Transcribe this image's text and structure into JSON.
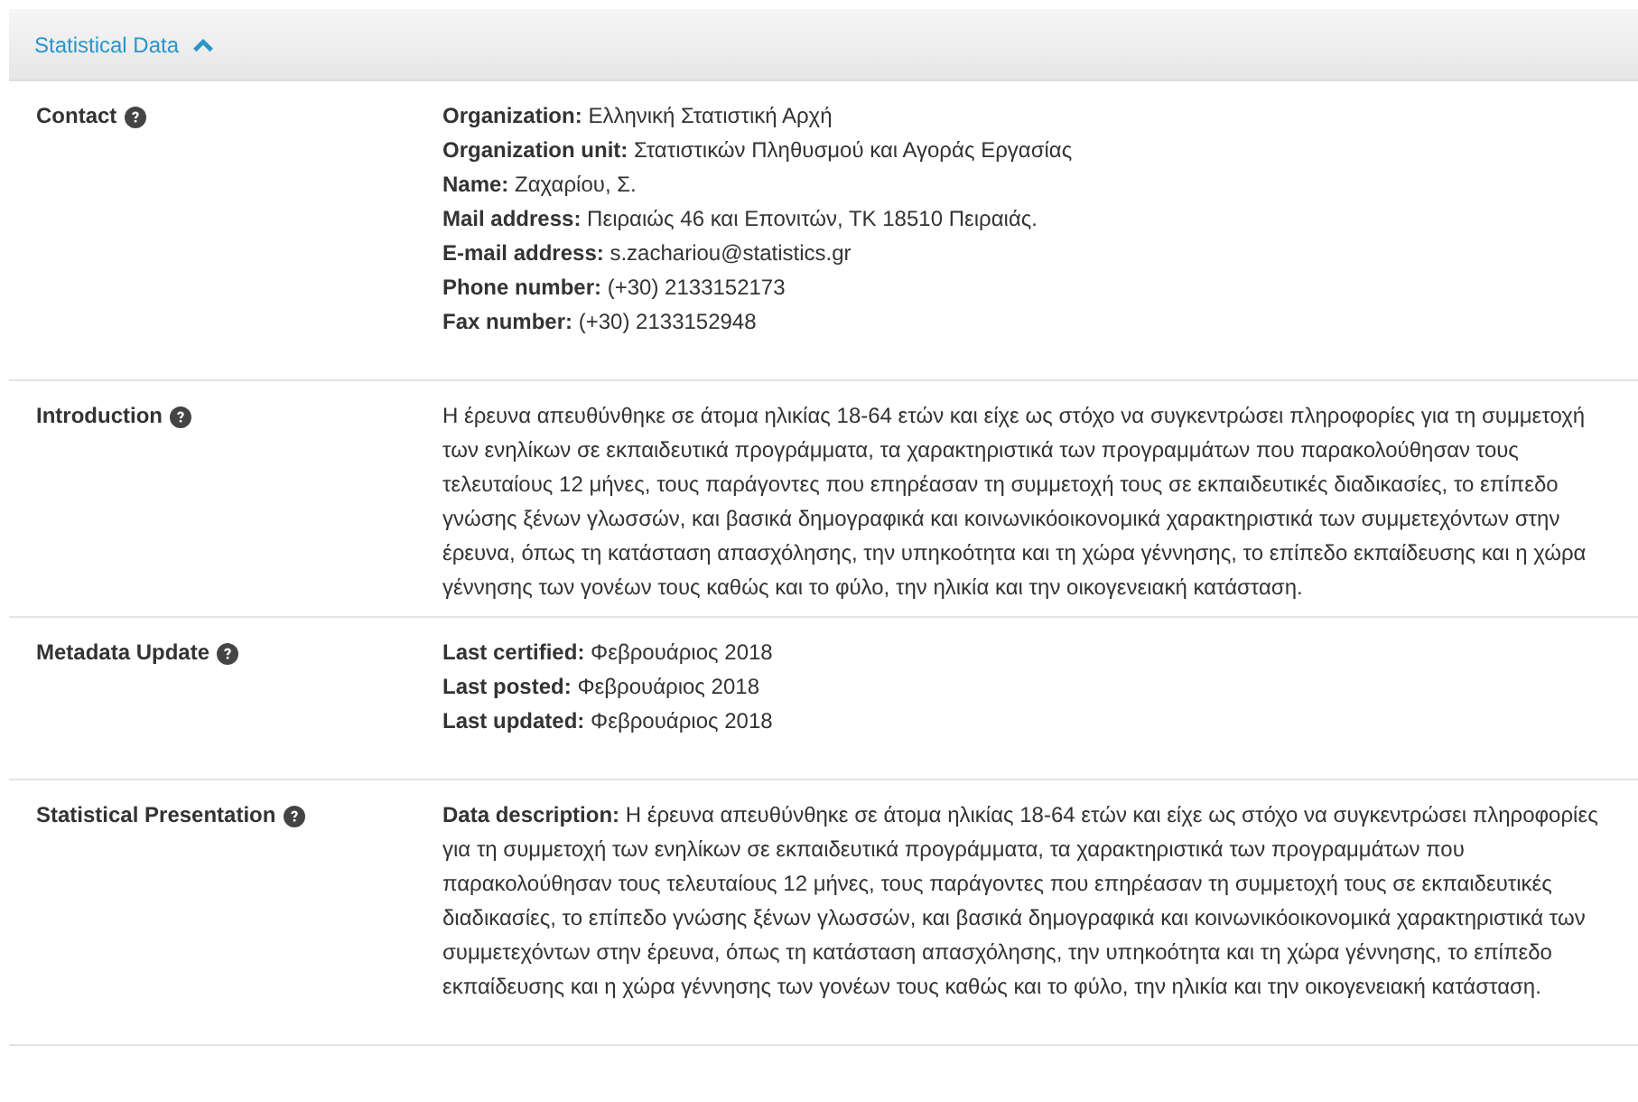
{
  "panel": {
    "title": "Statistical Data",
    "expanded": true
  },
  "sections": [
    {
      "label": "Contact",
      "kind": "fields",
      "fields": [
        {
          "label": "Organization:",
          "value": "Ελληνική Στατιστική Αρχή"
        },
        {
          "label": "Organization unit:",
          "value": "Στατιστικών Πληθυσμού και Αγοράς Εργασίας"
        },
        {
          "label": "Name:",
          "value": "Ζαχαρίου, Σ."
        },
        {
          "label": "Mail address:",
          "value": "Πειραιώς 46 και Επονιτών, ΤΚ 18510 Πειραιάς."
        },
        {
          "label": "E-mail address:",
          "value": "s.zachariou@statistics.gr"
        },
        {
          "label": "Phone number:",
          "value": "(+30) 2133152173"
        },
        {
          "label": "Fax number:",
          "value": "(+30) 2133152948"
        }
      ]
    },
    {
      "label": "Introduction",
      "kind": "text",
      "text": "Η έρευνα απευθύνθηκε σε άτομα ηλικίας 18-64 ετών και είχε ως στόχο να συγκεντρώσει πληροφορίες για τη συμμετοχή των ενηλίκων σε εκπαιδευτικά προγράμματα, τα χαρακτηριστικά των προγραμμάτων που παρακολούθησαν τους τελευταίους 12 μήνες, τους παράγοντες που επηρέασαν τη συμμετοχή τους σε εκπαιδευτικές διαδικασίες, το επίπεδο γνώσης ξένων γλωσσών, και βασικά δημογραφικά και κοινωνικόοικονομικά χαρακτηριστικά των συμμετεχόντων στην έρευνα, όπως τη κατάσταση απασχόλησης, την υπηκοότητα και τη χώρα γέννησης, το επίπεδο εκπαίδευσης και η χώρα γέννησης των γονέων τους καθώς και το φύλο, την ηλικία και την οικογενειακή κατάσταση."
    },
    {
      "label": "Metadata Update",
      "kind": "fields",
      "fields": [
        {
          "label": "Last certified:",
          "value": "Φεβρουάριος 2018"
        },
        {
          "label": "Last posted:",
          "value": "Φεβρουάριος 2018"
        },
        {
          "label": "Last updated:",
          "value": "Φεβρουάριος 2018"
        }
      ]
    },
    {
      "label": "Statistical Presentation",
      "kind": "fields",
      "fields": [
        {
          "label": "Data description:",
          "value": "Η έρευνα απευθύνθηκε σε άτομα ηλικίας 18-64 ετών και είχε ως στόχο να συγκεντρώσει πληροφορίες για τη συμμετοχή των ενηλίκων σε εκπαιδευτικά προγράμματα, τα χαρακτηριστικά των προγραμμάτων που παρακολούθησαν τους τελευταίους 12 μήνες, τους παράγοντες που επηρέασαν τη συμμετοχή τους σε εκπαιδευτικές διαδικασίες, το επίπεδο γνώσης ξένων γλωσσών, και βασικά δημογραφικά και κοινωνικόοικονομικά χαρακτηριστικά των συμμετεχόντων στην έρευνα, όπως τη κατάσταση απασχόλησης, την υπηκοότητα και τη χώρα γέννησης, το επίπεδο εκπαίδευσης και η χώρα γέννησης των γονέων τους καθώς και το φύλο, την ηλικία και την οικογενειακή κατάσταση."
        }
      ]
    }
  ]
}
